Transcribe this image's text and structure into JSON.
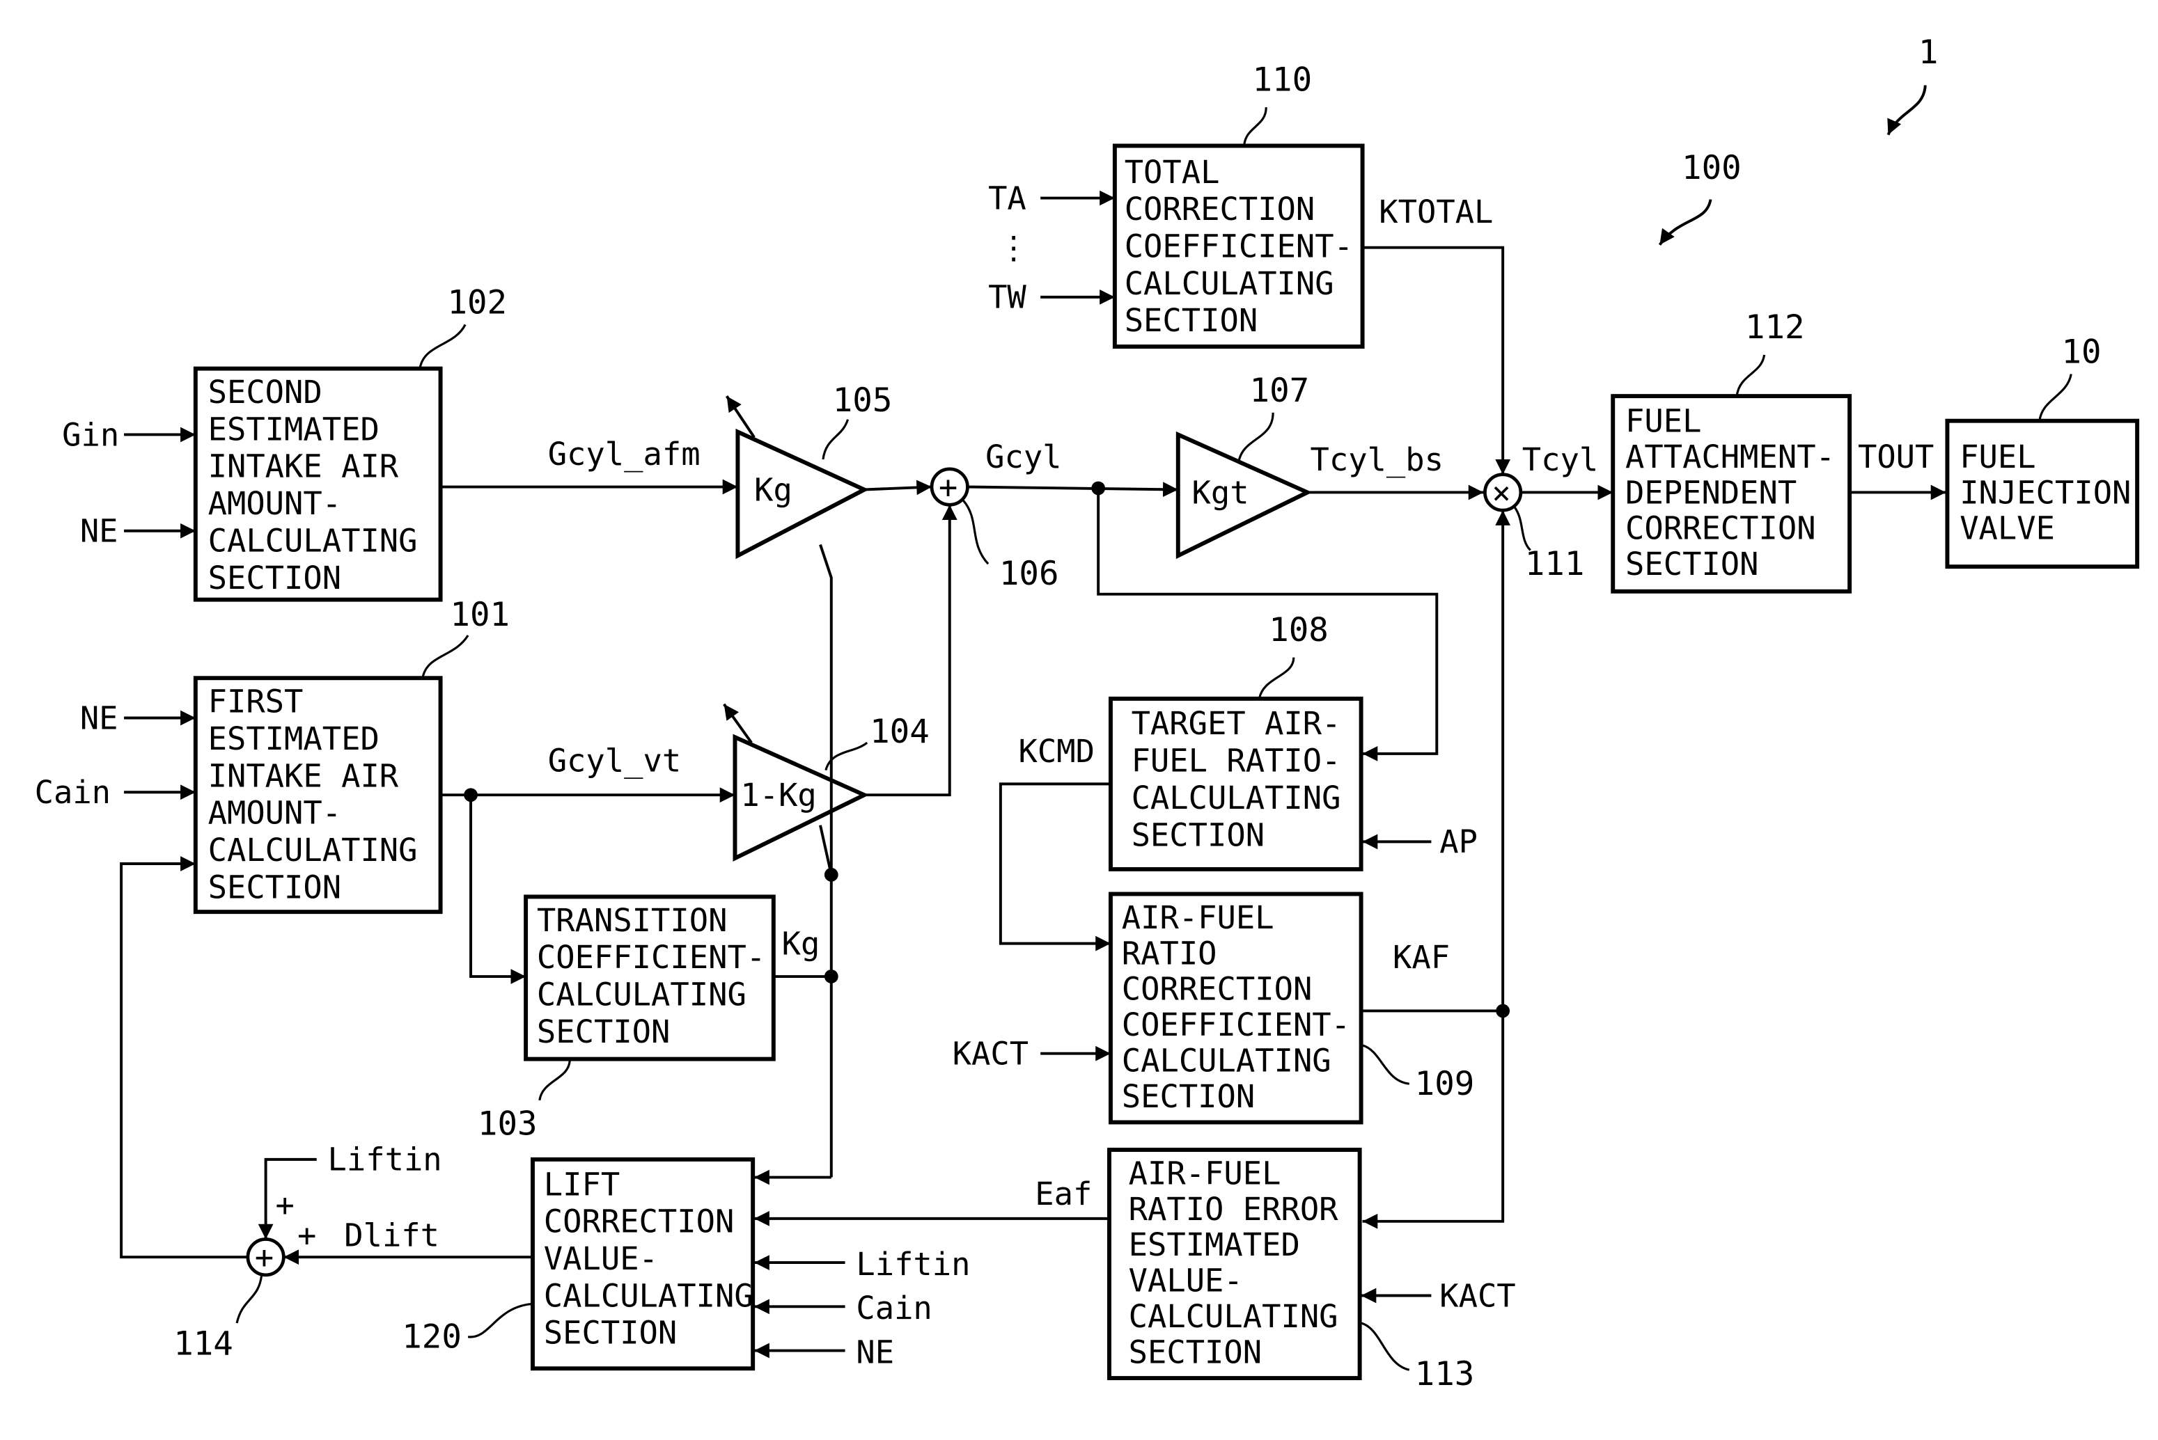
{
  "figure": {
    "system_ref": "1",
    "controller_ref": "100"
  },
  "blocks": {
    "b102": {
      "ref": "102",
      "lines": [
        "SECOND",
        "ESTIMATED",
        "INTAKE AIR",
        "AMOUNT-",
        "CALCULATING",
        "SECTION"
      ]
    },
    "b101": {
      "ref": "101",
      "lines": [
        "FIRST",
        "ESTIMATED",
        "INTAKE AIR",
        "AMOUNT-",
        "CALCULATING",
        "SECTION"
      ]
    },
    "b103": {
      "ref": "103",
      "lines": [
        "TRANSITION",
        "COEFFICIENT-",
        "CALCULATING",
        "SECTION"
      ]
    },
    "b110": {
      "ref": "110",
      "lines": [
        "TOTAL",
        "CORRECTION",
        "COEFFICIENT-",
        "CALCULATING",
        "SECTION"
      ]
    },
    "b108": {
      "ref": "108",
      "lines": [
        "TARGET AIR-",
        "FUEL RATIO-",
        "CALCULATING",
        "SECTION"
      ]
    },
    "b109": {
      "ref": "109",
      "lines": [
        "AIR-FUEL",
        "RATIO",
        "CORRECTION",
        "COEFFICIENT-",
        "CALCULATING",
        "SECTION"
      ]
    },
    "b113": {
      "ref": "113",
      "lines": [
        "AIR-FUEL",
        "RATIO ERROR",
        "ESTIMATED",
        "VALUE-",
        "CALCULATING",
        "SECTION"
      ]
    },
    "b120": {
      "ref": "120",
      "lines": [
        "LIFT",
        "CORRECTION",
        "VALUE-",
        "CALCULATING",
        "SECTION"
      ]
    },
    "b112": {
      "ref": "112",
      "lines": [
        "FUEL",
        "ATTACHMENT-",
        "DEPENDENT",
        "CORRECTION",
        "SECTION"
      ]
    },
    "b10": {
      "ref": "10",
      "lines": [
        "FUEL",
        "INJECTION",
        "VALVE"
      ]
    }
  },
  "amplifiers": {
    "a105": {
      "ref": "105",
      "gain": "Kg"
    },
    "a104": {
      "ref": "104",
      "gain": "1-Kg"
    },
    "a107": {
      "ref": "107",
      "gain": "Kgt"
    }
  },
  "operators": {
    "o106": {
      "ref": "106",
      "symbol": "+"
    },
    "o111": {
      "ref": "111",
      "symbol": "×"
    },
    "o114": {
      "ref": "114",
      "symbol": "+",
      "sign_top": "+",
      "sign_right": "+"
    }
  },
  "signals": {
    "gin": "Gin",
    "ne1": "NE",
    "ne2": "NE",
    "cain1": "Cain",
    "gcyl_afm": "Gcyl_afm",
    "gcyl_vt": "Gcyl_vt",
    "gcyl": "Gcyl",
    "tcyl_bs": "Tcyl_bs",
    "tcyl": "Tcyl",
    "tout": "TOUT",
    "ktotal": "KTOTAL",
    "ta": "TA",
    "ellipsis": "⋮",
    "tw": "TW",
    "kg": "Kg",
    "kcmd": "KCMD",
    "ap": "AP",
    "kaf": "KAF",
    "kact1": "KACT",
    "kact2": "KACT",
    "eaf": "Eaf",
    "liftin1": "Liftin",
    "liftin2": "Liftin",
    "cain2": "Cain",
    "ne3": "NE",
    "dlift": "Dlift"
  }
}
